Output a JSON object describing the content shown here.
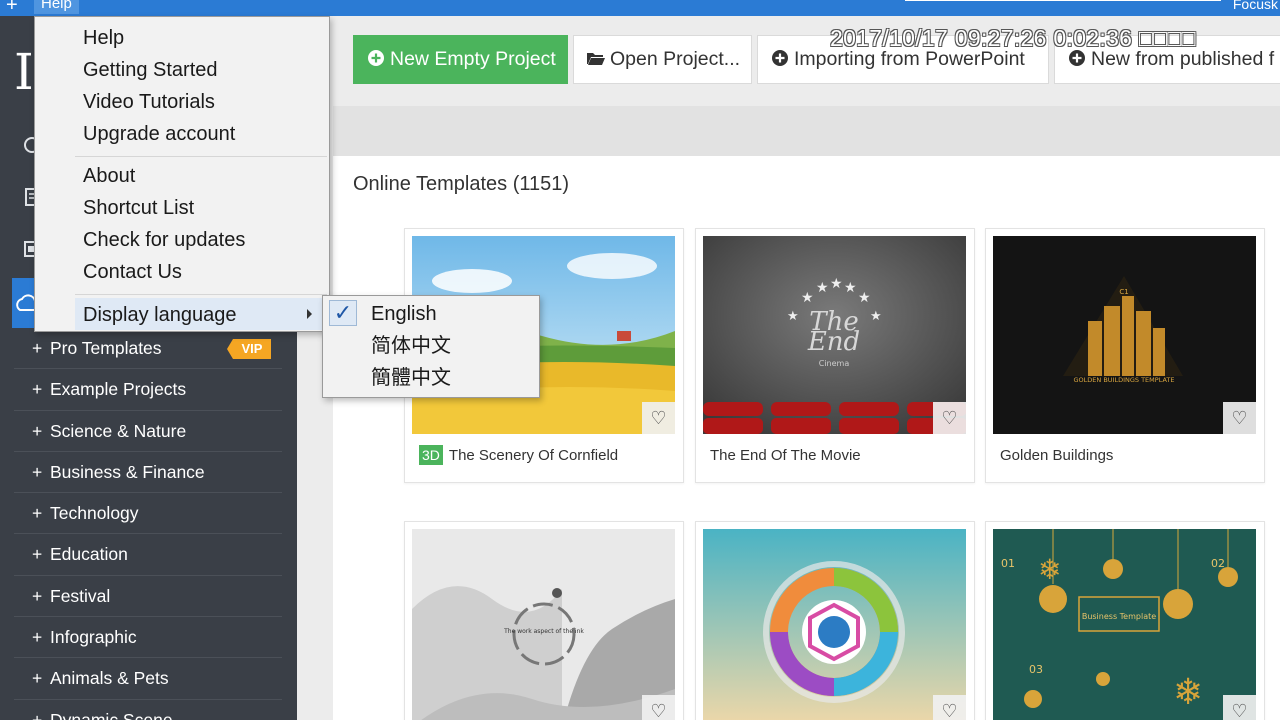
{
  "menubar": {
    "plus": "+",
    "help": "Help",
    "app_name": "Focusk"
  },
  "timestamp": "2017/10/17 09:27:26 0:02:36 □□□□",
  "sidebar": {
    "logo": "I",
    "categories": [
      {
        "label": "Pro Templates",
        "vip": "VIP"
      },
      {
        "label": "Example Projects"
      },
      {
        "label": "Science & Nature"
      },
      {
        "label": "Business & Finance"
      },
      {
        "label": "Technology"
      },
      {
        "label": "Education"
      },
      {
        "label": "Festival"
      },
      {
        "label": "Infographic"
      },
      {
        "label": "Animals & Pets"
      },
      {
        "label": "Dynamic Scene"
      }
    ]
  },
  "toolbar": {
    "new_empty": "New Empty Project",
    "open": "Open Project...",
    "import_ppt": "Importing from PowerPoint",
    "new_published": "New from published f"
  },
  "content": {
    "section_title": "Online Templates (1151)",
    "templates": [
      {
        "badge": "3D",
        "title": "The Scenery Of Cornfield"
      },
      {
        "title": "The End Of The Movie",
        "thumb_text_1": "The",
        "thumb_text_2": "End",
        "thumb_text_3": "Cinema"
      },
      {
        "title": "Golden Buildings",
        "thumb_text": "GOLDEN BUILDINGS TEMPLATE",
        "thumb_label": "C1"
      },
      {
        "title": "",
        "thumb_text": "The work aspect of the ink"
      },
      {
        "title": ""
      },
      {
        "title": "",
        "thumb_text": "Business Template",
        "num1": "01",
        "num2": "02",
        "num3": "03"
      }
    ]
  },
  "help_menu": {
    "items_group1": [
      "Help",
      "Getting Started",
      "Video Tutorials",
      "Upgrade account"
    ],
    "items_group2": [
      "About",
      "Shortcut List",
      "Check for updates",
      "Contact Us"
    ],
    "display_language": "Display language"
  },
  "language_menu": {
    "check": "✓",
    "options": [
      "English",
      "简体中文",
      "簡體中文"
    ],
    "selected": "English"
  },
  "colors": {
    "menubar": "#2b7bd4",
    "sidebar": "#3a3f47",
    "primary_button": "#4bb45c",
    "vip": "#f5a623"
  }
}
